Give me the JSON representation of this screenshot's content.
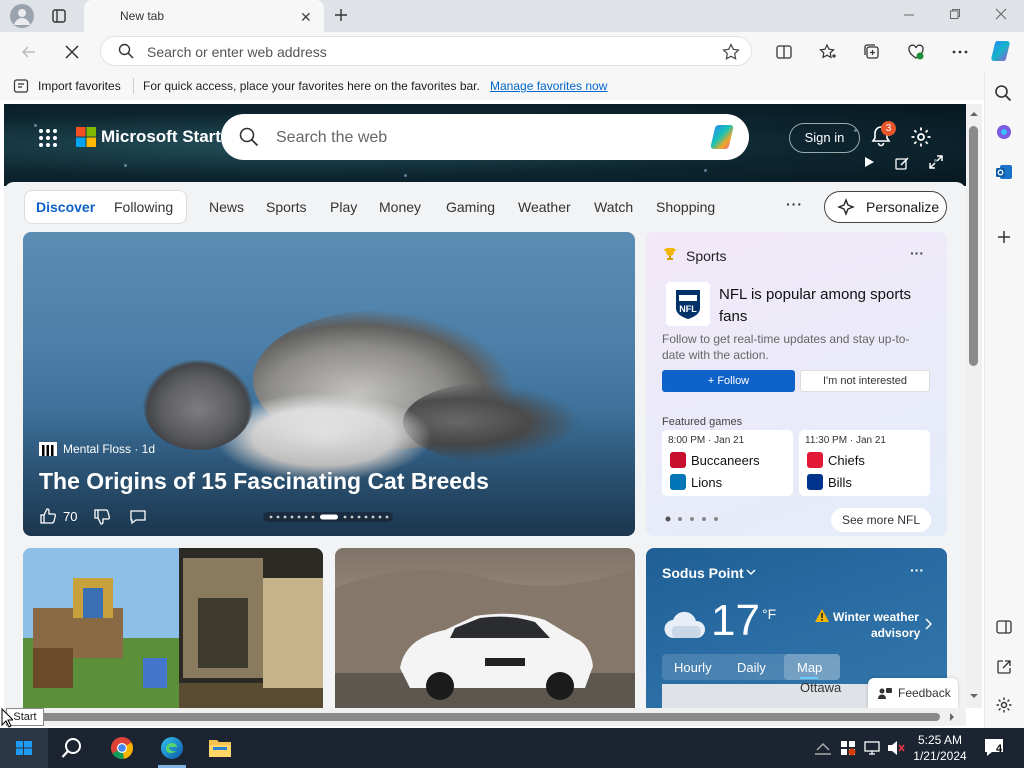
{
  "browser": {
    "tab_title": "New tab",
    "address_placeholder": "Search or enter web address"
  },
  "favorites_bar": {
    "import_label": "Import favorites",
    "hint": "For quick access, place your favorites here on the favorites bar.",
    "manage_link": "Manage favorites now"
  },
  "header": {
    "brand": "Microsoft Start",
    "search_placeholder": "Search the web",
    "signin_label": "Sign in",
    "notification_count": "3"
  },
  "nav": {
    "tabs": [
      "Discover",
      "Following",
      "News",
      "Sports",
      "Play",
      "Money",
      "Gaming",
      "Weather",
      "Watch",
      "Shopping"
    ],
    "more": "···",
    "personalize_label": "Personalize"
  },
  "hero": {
    "source": "Mental Floss · 1d",
    "title": "The Origins of 15 Fascinating Cat Breeds",
    "likes": "70"
  },
  "sports": {
    "header": "Sports",
    "more": "···",
    "headline": "NFL is popular among sports fans",
    "description": "Follow to get real-time updates and stay up-to-date with the action.",
    "follow_label": "+ Follow",
    "not_interested_label": "I'm not interested",
    "featured_label": "Featured games",
    "games": [
      {
        "time": "8:00 PM · Jan 21",
        "team1": "Buccaneers",
        "team2": "Lions"
      },
      {
        "time": "11:30 PM · Jan 21",
        "team1": "Chiefs",
        "team2": "Bills"
      }
    ],
    "see_more_label": "See more NFL"
  },
  "weather": {
    "location": "Sodus Point",
    "more": "···",
    "temperature": "17",
    "unit": "°F",
    "alert_line1": "Winter weather",
    "alert_line2": "advisory",
    "tabs": [
      "Hourly",
      "Daily",
      "Map"
    ],
    "map_label": "Ottawa"
  },
  "feedback_label": "Feedback",
  "tooltip": "Start",
  "taskbar": {
    "time": "5:25 AM",
    "date": "1/21/2024",
    "notifications": "4"
  },
  "colors": {
    "accent": "#0f62c9",
    "link": "#0066cc",
    "taskbar": "#1b2430"
  }
}
